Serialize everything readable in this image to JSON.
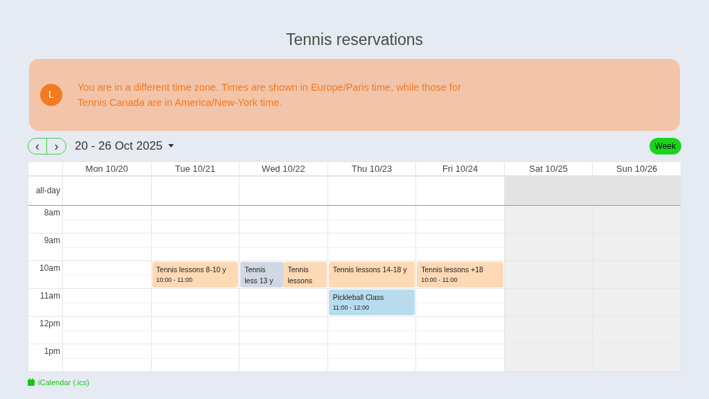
{
  "title": "Tennis reservations",
  "notice": {
    "avatar": "L",
    "text": "You are in a different time zone. Times are shown in Europe/Paris time, while those for Tennis Canada are in America/New-York time."
  },
  "toolbar": {
    "prev": "‹",
    "next": "›",
    "range": "20 - 26 Oct 2025",
    "views": [
      {
        "label": "Week",
        "selected": true
      }
    ]
  },
  "days": [
    {
      "label": "Mon 10/20",
      "weekend": false
    },
    {
      "label": "Tue 10/21",
      "weekend": false
    },
    {
      "label": "Wed 10/22",
      "weekend": false
    },
    {
      "label": "Thu 10/23",
      "weekend": false
    },
    {
      "label": "Fri 10/24",
      "weekend": false
    },
    {
      "label": "Sat 10/25",
      "weekend": true
    },
    {
      "label": "Sun 10/26",
      "weekend": true
    }
  ],
  "all_day_label": "all-day",
  "hours": [
    {
      "label": "8am",
      "cells": [
        [],
        [],
        [],
        [],
        [],
        [],
        []
      ]
    },
    {
      "label": "9am",
      "cells": [
        [],
        [],
        [],
        [],
        [],
        [],
        []
      ]
    },
    {
      "label": "10am",
      "cells": [
        [],
        [
          {
            "title": "Tennis lessons 8-10 y",
            "time": "10:00 - 11:00",
            "color": "#fdd9b5"
          }
        ],
        [
          {
            "title": "Tennis less 13 y",
            "color": "#d0d8e4"
          },
          {
            "title": "Tennis lessons",
            "color": "#fdd9b5"
          }
        ],
        [
          {
            "title": "Tennis lessons 14-18 y",
            "color": "#fdd9b5"
          }
        ],
        [
          {
            "title": "Tennis lessons +18",
            "time": "10:00 - 11:00",
            "color": "#fdd9b5"
          }
        ],
        [],
        []
      ]
    },
    {
      "label": "11am",
      "cells": [
        [],
        [],
        [],
        [
          {
            "title": "Pickleball Class",
            "time": "11:00 - 12:00",
            "color": "#b8dcee"
          }
        ],
        [],
        [],
        []
      ]
    },
    {
      "label": "12pm",
      "cells": [
        [],
        [],
        [],
        [],
        [],
        [],
        []
      ]
    },
    {
      "label": "1pm",
      "cells": [
        [],
        [],
        [],
        [],
        [],
        [],
        []
      ]
    }
  ],
  "export_link": "iCalendar (.ics)"
}
